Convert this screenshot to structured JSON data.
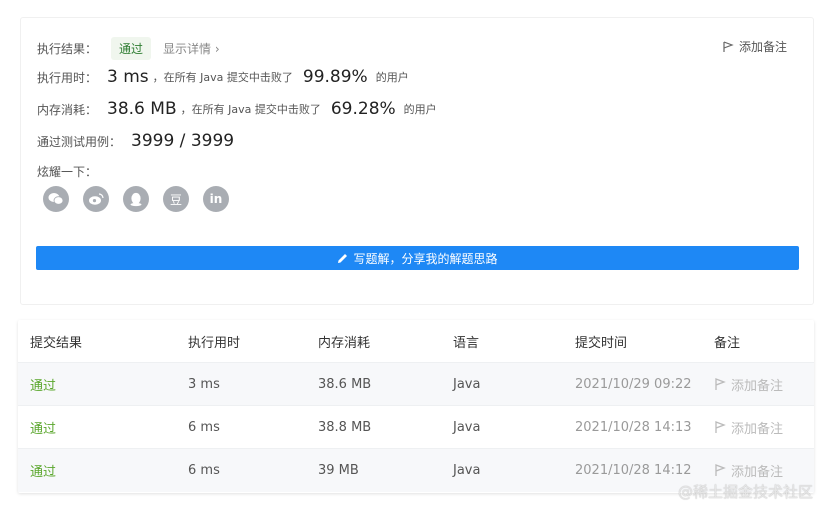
{
  "result": {
    "label": "执行结果：",
    "status": "通过",
    "details": "显示详情 ›",
    "add_note": "添加备注",
    "runtime": {
      "label": "执行用时：",
      "value": "3 ms",
      "beat_prefix": "，在所有 Java 提交中击败了",
      "percent": "99.89%",
      "suffix": "的用户"
    },
    "memory": {
      "label": "内存消耗：",
      "value": "38.6 MB",
      "beat_prefix": "，在所有 Java 提交中击败了",
      "percent": "69.28%",
      "suffix": "的用户"
    },
    "testcases": {
      "label": "通过测试用例：",
      "value": "3999 / 3999"
    },
    "share": {
      "label": "炫耀一下：",
      "icons": [
        "wechat-icon",
        "weibo-icon",
        "qq-icon",
        "douban-icon",
        "linkedin-icon"
      ],
      "douban_glyph": "豆",
      "linkedin_glyph": "in"
    },
    "write_solution": "写题解，分享我的解题思路"
  },
  "table": {
    "headers": [
      "提交结果",
      "执行用时",
      "内存消耗",
      "语言",
      "提交时间",
      "备注"
    ],
    "rows": [
      {
        "status": "通过",
        "runtime": "3 ms",
        "memory": "38.6 MB",
        "language": "Java",
        "time": "2021/10/29 09:22",
        "note": "添加备注"
      },
      {
        "status": "通过",
        "runtime": "6 ms",
        "memory": "38.8 MB",
        "language": "Java",
        "time": "2021/10/28 14:13",
        "note": "添加备注"
      },
      {
        "status": "通过",
        "runtime": "6 ms",
        "memory": "39 MB",
        "language": "Java",
        "time": "2021/10/28 14:12",
        "note": "添加备注"
      }
    ]
  },
  "watermark": "@稀土掘金技术社区",
  "colors": {
    "accent": "#1e88f5",
    "success": "#5aa62c",
    "status_bg": "#f0f6ee"
  }
}
